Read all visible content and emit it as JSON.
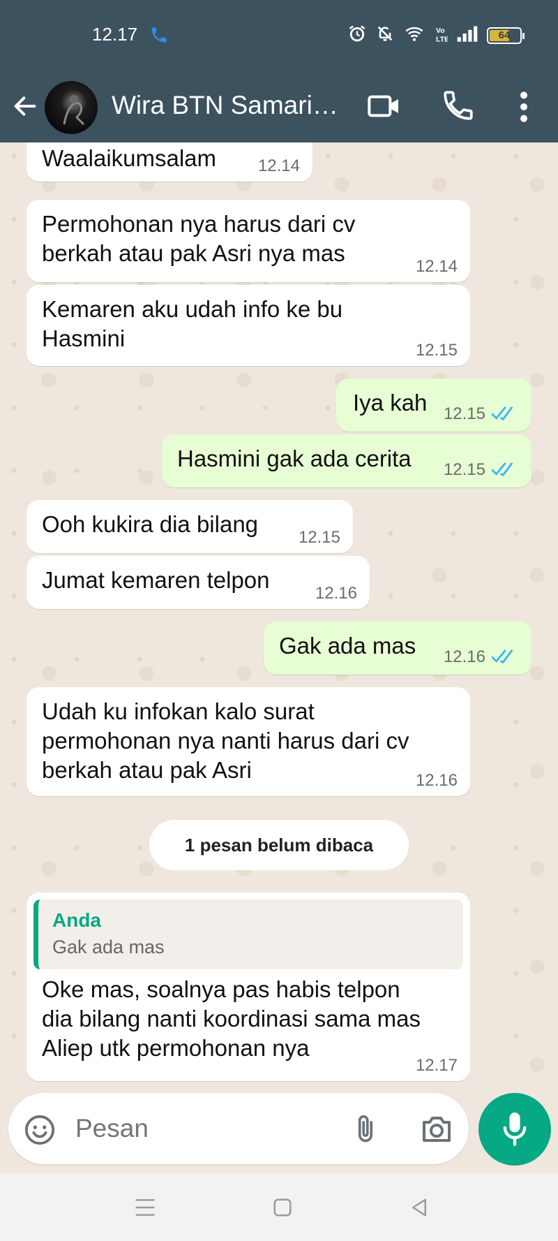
{
  "status_bar": {
    "time": "12.17",
    "battery_level": "64",
    "battery_fraction": 0.64
  },
  "header": {
    "contact_name": "Wira BTN Samarin…"
  },
  "messages": [
    {
      "direction": "in",
      "text": "Waalaikumsalam",
      "time": "12.14"
    },
    {
      "direction": "in",
      "text": "Permohonan nya harus dari cv berkah atau pak Asri nya mas",
      "time": "12.14"
    },
    {
      "direction": "in",
      "text": "Kemaren aku udah info ke bu Hasmini",
      "time": "12.15"
    },
    {
      "direction": "out",
      "text": "Iya kah",
      "time": "12.15",
      "status": "read"
    },
    {
      "direction": "out",
      "text": "Hasmini gak ada cerita",
      "time": "12.15",
      "status": "read"
    },
    {
      "direction": "in",
      "text": "Ooh kukira dia bilang",
      "time": "12.15"
    },
    {
      "direction": "in",
      "text": "Jumat kemaren telpon",
      "time": "12.16"
    },
    {
      "direction": "out",
      "text": "Gak ada mas",
      "time": "12.16",
      "status": "read"
    },
    {
      "direction": "in",
      "text": "Udah ku infokan kalo surat permohonan nya nanti harus dari cv berkah atau pak Asri",
      "time": "12.16"
    }
  ],
  "unread_divider": "1 pesan belum dibaca",
  "reply_message": {
    "quote_author": "Anda",
    "quote_text": "Gak ada mas",
    "text": "Oke mas, soalnya pas habis telpon dia bilang nanti koordinasi sama mas Aliep utk permohonan nya",
    "time": "12.17"
  },
  "composer": {
    "placeholder": "Pesan"
  },
  "colors": {
    "header": "#3c525e",
    "accent": "#07a884",
    "outgoing_bubble": "#e7fdd3",
    "read_ticks": "#34b7f1"
  }
}
